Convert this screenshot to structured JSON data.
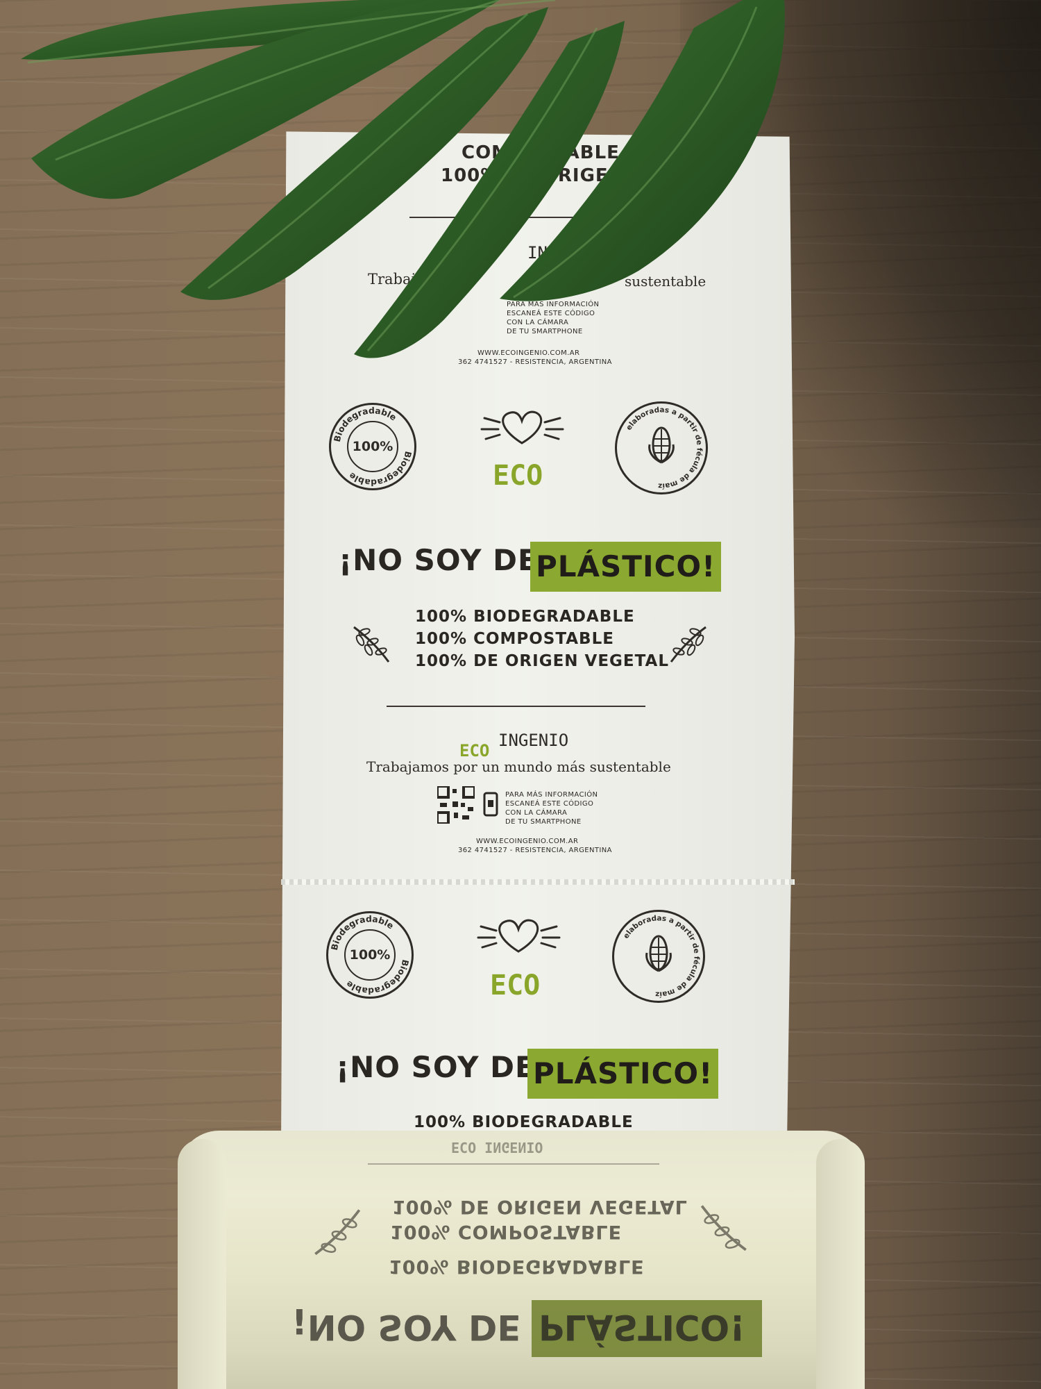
{
  "bag_top": {
    "line1": "COMPOSTABLE",
    "line2": "100% DE ORIGEN VEGETAL",
    "brand_ingenio": "INGENIO",
    "tagline_start": "Trabajamos",
    "tagline_end": "sustentable",
    "qr_text": [
      "PARA MÁS INFORMACIÓN",
      "ESCANEÁ ESTE CÓDIGO",
      "CON LA CÁMARA",
      "DE TU SMARTPHONE"
    ],
    "website": "WWW.ECOINGENIO.COM.AR",
    "contact": "362 4741527 - RESISTENCIA, ARGENTINA"
  },
  "bag_section_1": {
    "seal_left_center": "100%",
    "seal_left_ring": "Biodegradable",
    "seal_right_ring": "elaboradas a partir de fécula de maíz",
    "eco_label": "ECO",
    "headline_start": "¡NO SOY DE",
    "headline_highlight": "PLÁSTICO!",
    "claims": [
      "100% BIODEGRADABLE",
      "100% COMPOSTABLE",
      "100% DE ORIGEN VEGETAL"
    ],
    "brand_eco": "ECO",
    "brand_ingenio": "INGENIO",
    "tagline": "Trabajamos por un mundo más sustentable",
    "qr_text": [
      "PARA MÁS INFORMACIÓN",
      "ESCANEÁ ESTE CÓDIGO",
      "CON LA CÁMARA",
      "DE TU SMARTPHONE"
    ],
    "website": "WWW.ECOINGENIO.COM.AR",
    "contact": "362 4741527 - RESISTENCIA, ARGENTINA"
  },
  "bag_section_2": {
    "seal_left_center": "100%",
    "seal_left_ring": "Biodegradable",
    "seal_right_ring": "elaboradas a partir de fécula de maíz",
    "eco_label": "ECO",
    "headline_start": "¡NO SOY DE",
    "headline_highlight": "PLÁSTICO!",
    "claim_visible": "100% BIODEGRADABLE"
  },
  "roll": {
    "brand": "ECO INGENIO",
    "claims_mirrored": [
      "100% DE ORIGEN VEGETAL",
      "100% COMPOSTABLE",
      "100% BIODEGRADABLE"
    ],
    "headline_start": "¡NO SOY DE",
    "headline_highlight": "PLÁSTICO!"
  },
  "colors": {
    "brand_green": "#8ba830",
    "ink": "#2a2622",
    "leaf": "#2f5a26"
  }
}
